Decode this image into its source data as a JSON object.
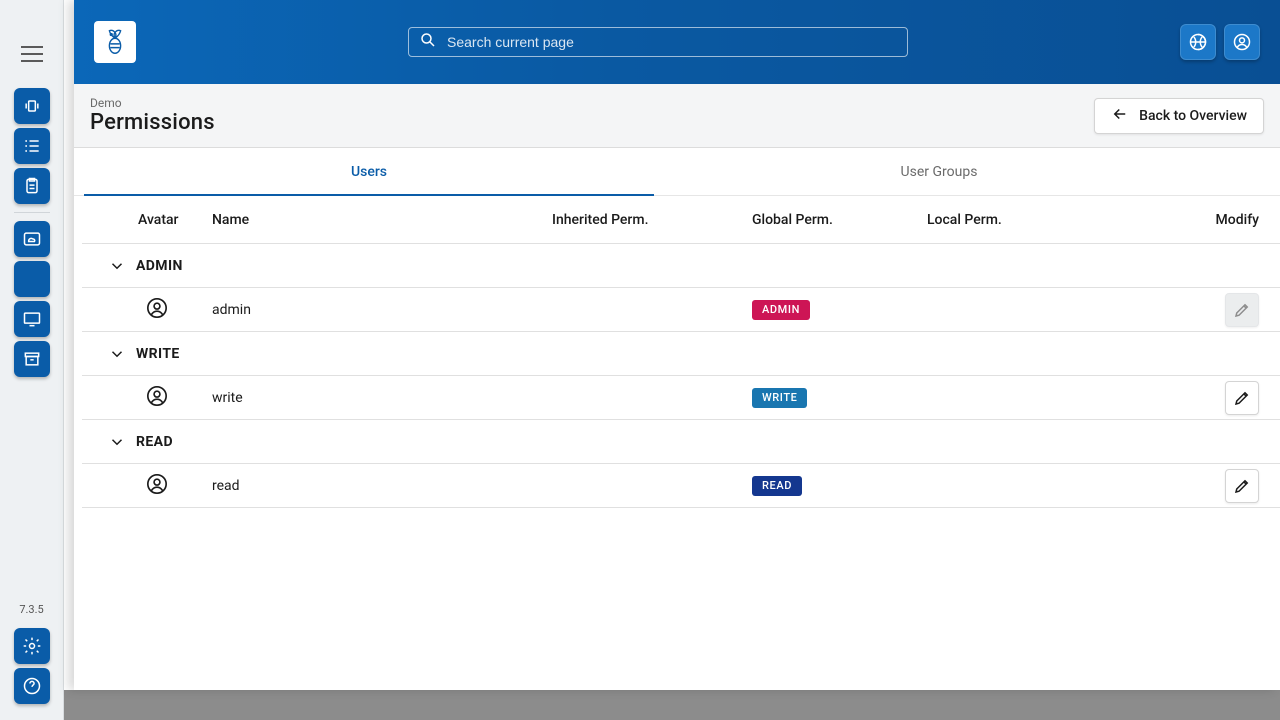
{
  "version": "7.3.5",
  "search": {
    "placeholder": "Search current page"
  },
  "header": {
    "breadcrumb": "Demo",
    "title": "Permissions",
    "back_label": "Back to Overview"
  },
  "tabs": {
    "users": "Users",
    "groups": "User Groups",
    "active": "users"
  },
  "columns": {
    "avatar": "Avatar",
    "name": "Name",
    "inherited": "Inherited Perm.",
    "global": "Global Perm.",
    "local": "Local Perm.",
    "modify": "Modify"
  },
  "groups": [
    {
      "label": "ADMIN",
      "rows": [
        {
          "name": "admin",
          "global": {
            "label": "ADMIN",
            "color": "#cd1555"
          },
          "editable": false
        }
      ]
    },
    {
      "label": "WRITE",
      "rows": [
        {
          "name": "write",
          "global": {
            "label": "WRITE",
            "color": "#1976b0"
          },
          "editable": true
        }
      ]
    },
    {
      "label": "READ",
      "rows": [
        {
          "name": "read",
          "global": {
            "label": "READ",
            "color": "#14378f"
          },
          "editable": true
        }
      ]
    }
  ]
}
